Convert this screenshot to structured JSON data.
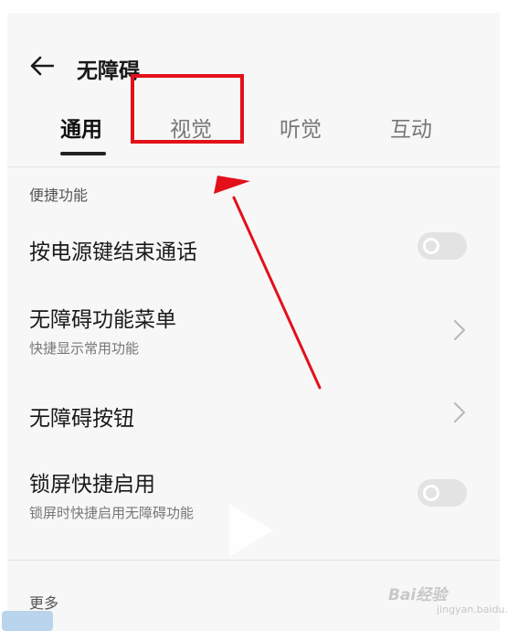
{
  "header": {
    "title": "无障碍"
  },
  "tabs": [
    {
      "label": "通用",
      "active": true
    },
    {
      "label": "视觉",
      "active": false
    },
    {
      "label": "听觉",
      "active": false
    },
    {
      "label": "互动",
      "active": false
    }
  ],
  "section_shortcuts": {
    "label": "便捷功能"
  },
  "rows": [
    {
      "title": "按电源键结束通话",
      "control": "toggle",
      "on": false
    },
    {
      "title": "无障碍功能菜单",
      "subtitle": "快捷显示常用功能",
      "control": "chevron"
    },
    {
      "title": "无障碍按钮",
      "control": "chevron"
    },
    {
      "title": "锁屏快捷启用",
      "subtitle": "锁屏时快捷启用无障碍功能",
      "control": "toggle",
      "on": false
    }
  ],
  "section_more": {
    "label": "更多"
  },
  "annotation": {
    "color": "#e3101a",
    "highlights_tab": "视觉"
  },
  "watermark": {
    "text": "Bai经验",
    "sub": "jingyan.baidu.com"
  },
  "colors": {
    "background": "#f7f7f7",
    "toggle_off": "#e3e3e3",
    "annotation_red": "#e3101a"
  }
}
